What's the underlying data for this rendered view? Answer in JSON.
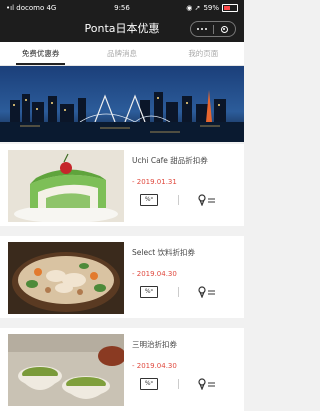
{
  "status_bar": {
    "carrier": "docomo",
    "network": "4G",
    "time": "9:56",
    "battery_text": "59%",
    "battery_level": 0.59
  },
  "nav": {
    "title": "Ponta日本优惠"
  },
  "tabs": [
    {
      "label": "免费优惠券",
      "active": true
    },
    {
      "label": "品牌消息",
      "active": false
    },
    {
      "label": "我的页面",
      "active": false
    }
  ],
  "coupons": [
    {
      "name": "Uchi Cafe 甜品折扣券",
      "date": "- 2019.01.31",
      "coupon_icon": "coupon-icon",
      "map_icon": "map-pin-icon"
    },
    {
      "name": "Select 饮料折扣券",
      "date": "- 2019.04.30",
      "coupon_icon": "coupon-icon",
      "map_icon": "map-pin-icon"
    },
    {
      "name": "三明治折扣券",
      "date": "- 2019.04.30",
      "coupon_icon": "coupon-icon",
      "map_icon": "map-pin-icon"
    }
  ],
  "icons": {
    "coupon_glyph": "%ᵒ",
    "menu": "more-dots-icon",
    "close": "target-icon"
  },
  "colors": {
    "nav_bg": "#1d1d1d",
    "date_red": "#e04a3f",
    "tab_active": "#222222"
  }
}
